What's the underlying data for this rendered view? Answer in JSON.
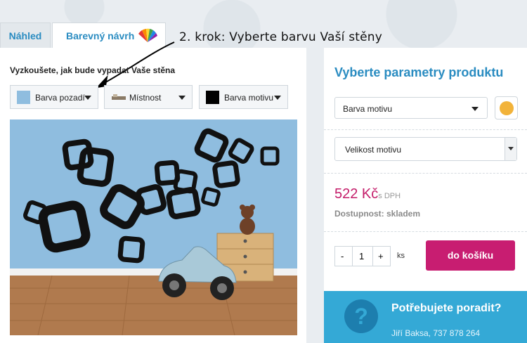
{
  "tabs": [
    {
      "label": "Náhled"
    },
    {
      "label": "Barevný návrh"
    }
  ],
  "annotation": "2. krok: Vyberte barvu Vaší stěny",
  "left": {
    "try_text": "Vyzkoušete, jak bude vypadat Vaše stěna",
    "selects": [
      {
        "label": "Barva pozadí",
        "swatch": "#8fbddf"
      },
      {
        "label": "Místnost"
      },
      {
        "label": "Barva motivu",
        "swatch": "#000000"
      }
    ]
  },
  "right": {
    "title": "Vyberte parametry produktu",
    "motif_color_select": "Barva motivu",
    "motif_color_value": "#f2b33a",
    "motif_size_select": "Velikost motivu",
    "price": "522 Kč",
    "price_note": "s DPH",
    "availability_label": "Dostupnost:",
    "availability_value": "skladem",
    "quantity": {
      "minus": "-",
      "value": "1",
      "plus": "+",
      "unit": "ks"
    },
    "cart_button": "do košíku"
  },
  "help": {
    "icon": "?",
    "title": "Potřebujete poradit?",
    "contact": "Jiří Baksa, 737 878 264"
  },
  "colors": {
    "accent": "#2a8cc1",
    "cart": "#c81d71",
    "help_bg": "#34a9d6",
    "wall": "#8fbddf"
  }
}
